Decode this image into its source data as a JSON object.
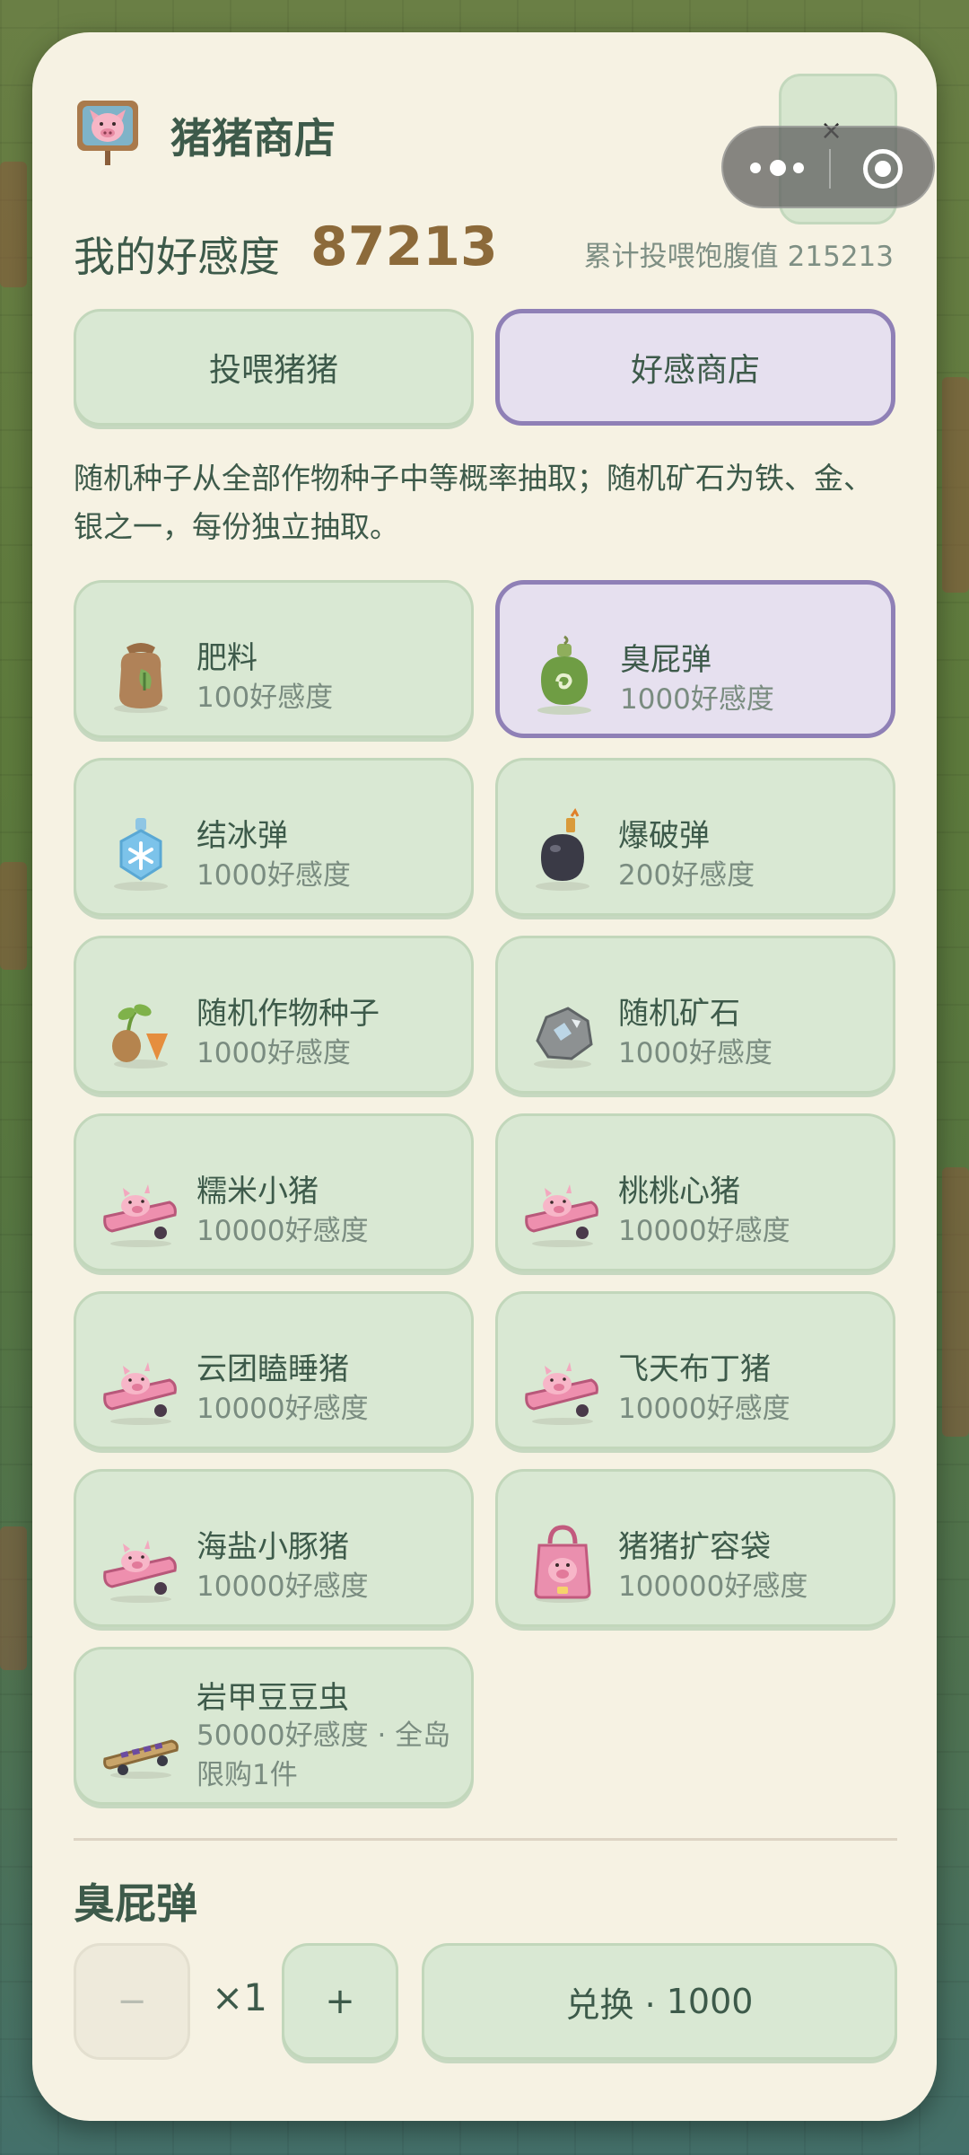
{
  "header": {
    "title": "猪猪商店",
    "affinity_label": "我的好感度",
    "affinity_value": "87213",
    "fed_total_label": "累计投喂饱腹值",
    "fed_total_value": "215213"
  },
  "capsule": {
    "close": "×"
  },
  "tabs": [
    {
      "label": "投喂猪猪",
      "active": false
    },
    {
      "label": "好感商店",
      "active": true
    }
  ],
  "description": "随机种子从全部作物种子中等概率抽取；随机矿石为铁、金、银之一，每份独立抽取。",
  "items": [
    {
      "name": "肥料",
      "price": "100好感度",
      "icon": "fertilizer-bag-icon"
    },
    {
      "name": "臭屁弹",
      "price": "1000好感度",
      "icon": "stink-bomb-icon",
      "selected": true
    },
    {
      "name": "结冰弹",
      "price": "1000好感度",
      "icon": "ice-bomb-icon"
    },
    {
      "name": "爆破弹",
      "price": "200好感度",
      "icon": "blast-bomb-icon"
    },
    {
      "name": "随机作物种子",
      "price": "1000好感度",
      "icon": "seed-sprout-icon"
    },
    {
      "name": "随机矿石",
      "price": "1000好感度",
      "icon": "ore-rock-icon"
    },
    {
      "name": "糯米小猪",
      "price": "10000好感度",
      "icon": "pig-skateboard-icon"
    },
    {
      "name": "桃桃心猪",
      "price": "10000好感度",
      "icon": "pig-skateboard-icon"
    },
    {
      "name": "云团瞌睡猪",
      "price": "10000好感度",
      "icon": "pig-skateboard-icon"
    },
    {
      "name": "飞天布丁猪",
      "price": "10000好感度",
      "icon": "pig-skateboard-icon"
    },
    {
      "name": "海盐小豚猪",
      "price": "10000好感度",
      "icon": "pig-skateboard-icon"
    },
    {
      "name": "猪猪扩容袋",
      "price": "100000好感度",
      "icon": "pig-bag-icon"
    },
    {
      "name": "岩甲豆豆虫",
      "price": "50000好感度 · 全岛限购1件",
      "icon": "beetle-board-icon"
    }
  ],
  "footer": {
    "selected_item": "臭屁弹",
    "minus": "−",
    "quantity": "×1",
    "plus": "+",
    "exchange_label": "兑换 ·",
    "exchange_cost": "1000"
  },
  "colors": {
    "panel": "#f6f2e3",
    "item_bg": "#d9e8d3",
    "selected_bg": "#e6e0ef",
    "selected_border": "#8f80b6",
    "affinity_value": "#8c6a3a"
  }
}
